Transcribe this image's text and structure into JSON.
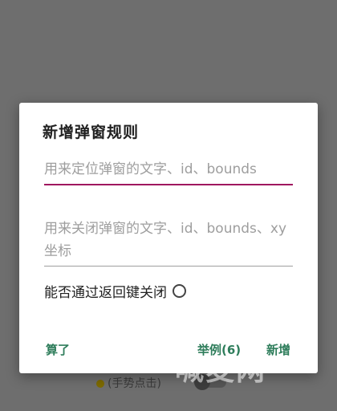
{
  "dialog": {
    "title": "新增弹窗规则",
    "field_locate_placeholder": "用来定位弹窗的文字、id、bounds",
    "field_close_placeholder": "用来关闭弹窗的文字、id、bounds、xy坐标",
    "back_key_label": "能否通过返回键关闭",
    "cancel_label": "算了",
    "example_label": "举例(6)",
    "add_label": "新增"
  },
  "background": {
    "hint_text": "(手势点击)"
  },
  "watermark": {
    "text": "喊麦网"
  },
  "colors": {
    "accent": "#a0185f",
    "button": "#2e7d5b",
    "scrim": "#6e6e6e"
  }
}
